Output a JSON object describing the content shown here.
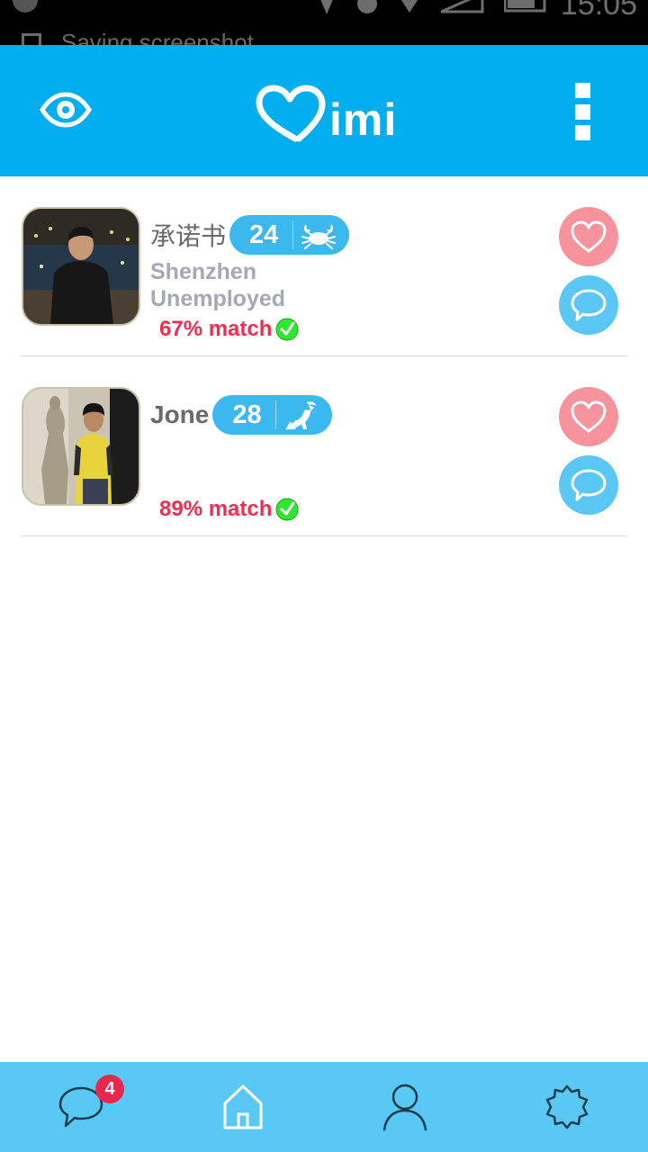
{
  "status_bar": {
    "notification": "Saving screenshot",
    "time": "15:05"
  },
  "app_bar": {
    "logo_text": "imi",
    "left_icon": "eye-icon",
    "right_icon": "overflow-menu-icon"
  },
  "matches": [
    {
      "name": "承诺书",
      "age": "24",
      "zodiac_icon": "crab-icon",
      "city": "Shenzhen",
      "occupation": "Unemployed",
      "match": "67% match"
    },
    {
      "name": "Jone",
      "age": "28",
      "zodiac_icon": "goat-icon",
      "city": "",
      "occupation": "",
      "match": "89% match"
    }
  ],
  "bottom_nav": {
    "messages_badge": "4",
    "items": [
      "chat-icon",
      "home-icon",
      "profile-icon",
      "settings-icon"
    ]
  },
  "colors": {
    "app_bar": "#03aeef",
    "bottom_nav": "#5ac8f4",
    "like": "#f7939d",
    "chat": "#5ac7f4",
    "match_text": "#ec2f52",
    "age_pill": "#3bb8ee",
    "badge": "#e8274f"
  }
}
